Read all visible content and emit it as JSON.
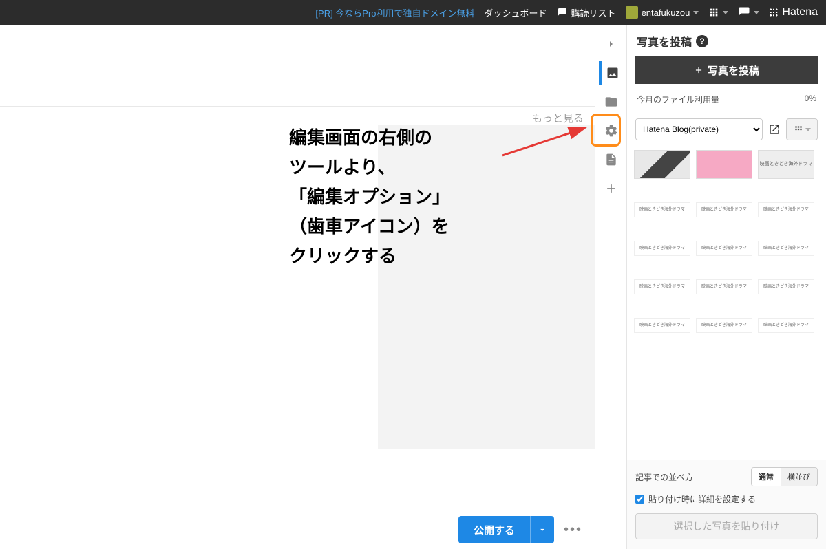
{
  "topbar": {
    "pr_link": "[PR] 今ならPro利用で独自ドメイン無料",
    "dashboard": "ダッシュボード",
    "reading_list": "購読リスト",
    "username": "entafukuzou",
    "brand": "Hatena"
  },
  "annotation": {
    "text": "編集画面の右側の\nツールより、\n「編集オプション」\n（歯車アイコン）を\nクリックする"
  },
  "editor": {
    "more": "もっと見る",
    "publish": "公開する"
  },
  "tool_icons": {
    "collapse": "chevron-right",
    "photo": "photo",
    "folder": "folder",
    "gear": "gear",
    "doc": "document",
    "plus": "plus"
  },
  "side": {
    "title": "写真を投稿",
    "upload": "写真を投稿",
    "usage_label": "今月のファイル利用量",
    "usage_value": "0%",
    "blog_select": "Hatena Blog(private)",
    "thumbs_misc": "映画ときどき海外ドラマ",
    "footer": {
      "layout_label": "記事での並べ方",
      "layout_normal": "通常",
      "layout_side": "横並び",
      "check_label": "貼り付け時に詳細を設定する",
      "paste": "選択した写真を貼り付け"
    }
  }
}
